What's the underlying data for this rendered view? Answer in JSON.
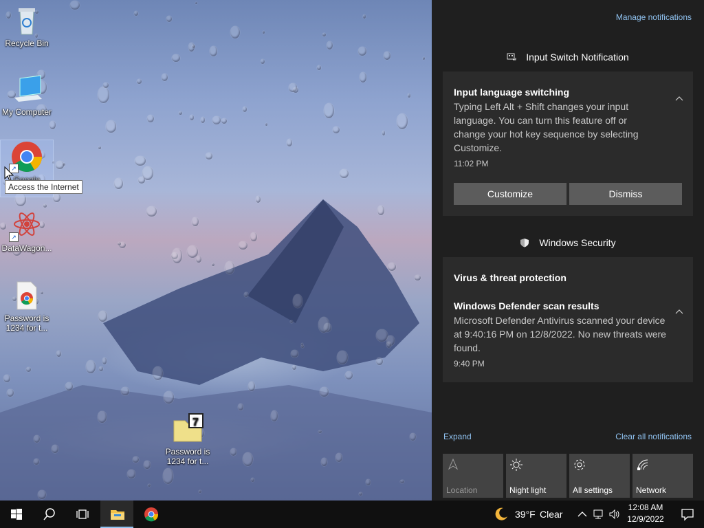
{
  "desktop": {
    "icons": [
      {
        "label": "Recycle Bin"
      },
      {
        "label": "My Computer"
      },
      {
        "label": "Google Chrome"
      },
      {
        "label": "DataWagon..."
      },
      {
        "label": "Password is 1234 for t..."
      },
      {
        "label": "Password is 1234 for t..."
      }
    ],
    "tooltip": "Access the Internet"
  },
  "action_center": {
    "manage_link": "Manage notifications",
    "groups": [
      {
        "title": "Input Switch Notification",
        "notification": {
          "title": "Input language switching",
          "body": "Typing Left Alt + Shift changes your input language. You can turn this feature off or change your hot key sequence by selecting Customize.",
          "time": "11:02 PM",
          "buttons": [
            "Customize",
            "Dismiss"
          ]
        }
      },
      {
        "title": "Windows Security",
        "header": "Virus & threat protection",
        "notification": {
          "title": "Windows Defender scan results",
          "body": "Microsoft Defender Antivirus scanned your device at 9:40:16 PM on 12/8/2022. No new threats were found.",
          "time": "9:40 PM"
        }
      }
    ],
    "expand": "Expand",
    "clear_all": "Clear all notifications",
    "quick_actions": [
      {
        "label": "Location",
        "icon": "location-icon",
        "enabled": false
      },
      {
        "label": "Night light",
        "icon": "brightness-icon",
        "enabled": true
      },
      {
        "label": "All settings",
        "icon": "gear-icon",
        "enabled": true
      },
      {
        "label": "Network",
        "icon": "network-icon",
        "enabled": true
      }
    ]
  },
  "taskbar": {
    "weather": {
      "temp": "39°F",
      "condition": "Clear"
    },
    "clock": {
      "time": "12:08 AM",
      "date": "12/9/2022"
    },
    "pinned": [
      "start-icon",
      "search-icon",
      "task-view-icon",
      "file-explorer-icon",
      "chrome-icon"
    ]
  },
  "colors": {
    "accent": "#8fc1ef",
    "panel": "#1f1f1f",
    "card": "#2b2b2b",
    "taskbar": "#101010"
  }
}
